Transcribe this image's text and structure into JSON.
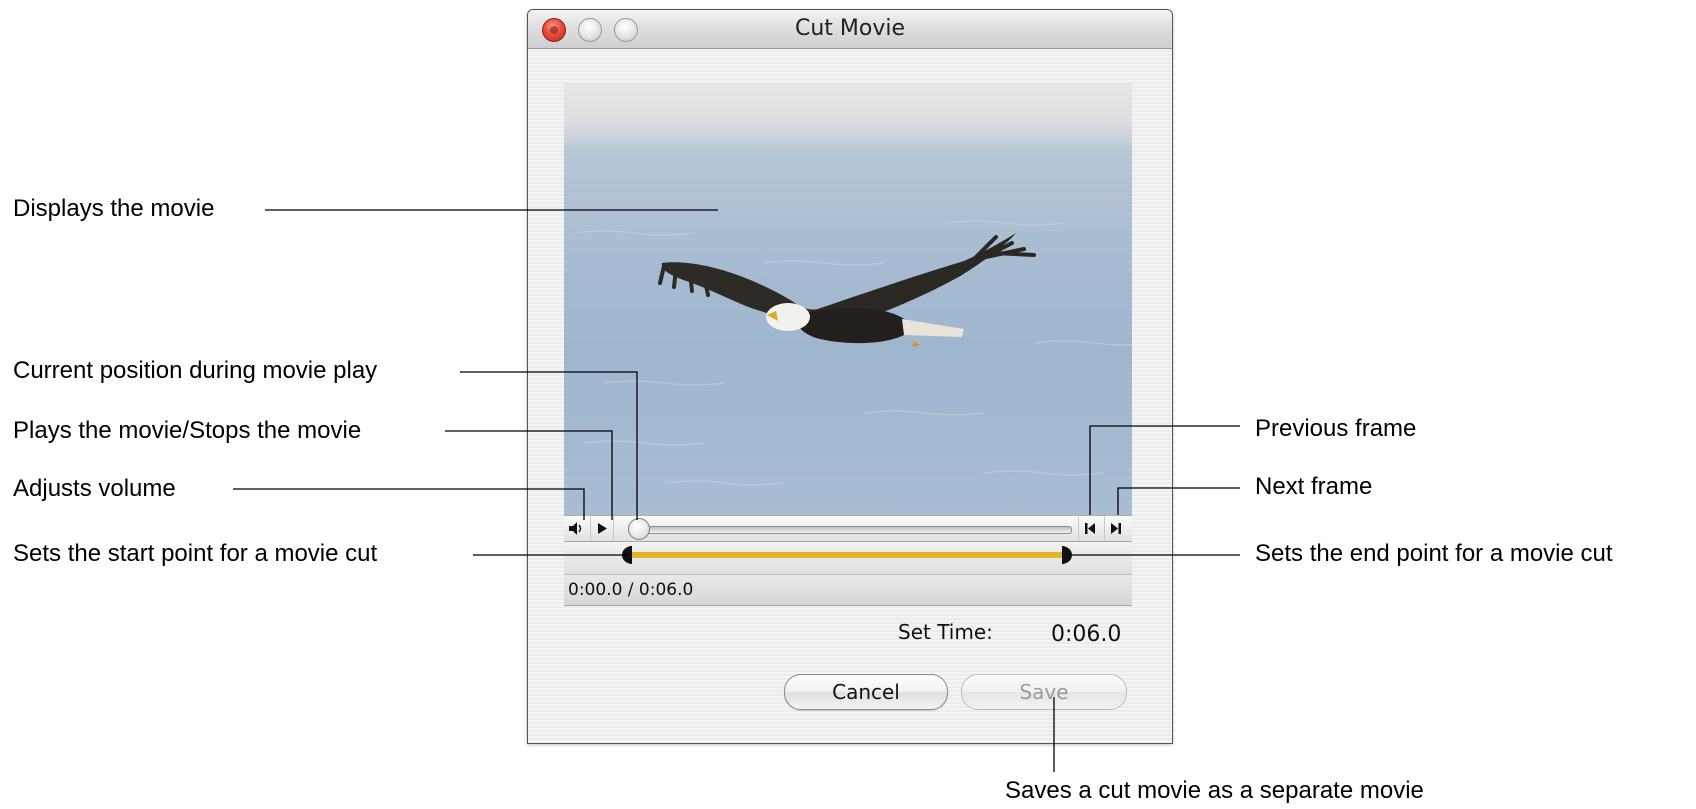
{
  "window": {
    "title": "Cut Movie"
  },
  "player": {
    "timecode": "0:00.0 / 0:06.0",
    "playhead_fraction": 0.0,
    "cut_start_fraction": 0.0,
    "cut_end_fraction": 1.0,
    "cut_range_color": "#e5b22c"
  },
  "set_time": {
    "label": "Set Time:",
    "value": "0:06.0"
  },
  "buttons": {
    "cancel": "Cancel",
    "save": "Save"
  },
  "callouts": {
    "displays_movie": "Displays the movie",
    "current_position": "Current position during movie play",
    "play_stop": "Plays the movie/Stops the movie",
    "adjusts_volume": "Adjusts volume",
    "start_point": "Sets the start point for a movie cut",
    "previous_frame": "Previous frame",
    "next_frame": "Next frame",
    "end_point": "Sets the end point for a movie cut",
    "saves_cut": "Saves a cut movie as a separate movie"
  },
  "icons": {
    "volume": "speaker-icon",
    "play": "play-icon",
    "previous_frame": "step-back-icon",
    "next_frame": "step-forward-icon"
  }
}
